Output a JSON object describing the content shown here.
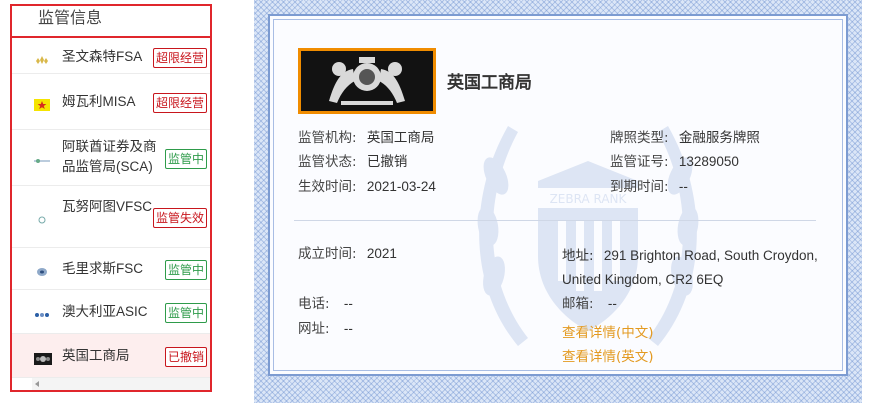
{
  "sidebar": {
    "title": "监管信息",
    "items": [
      {
        "name": "圣文森特FSA",
        "badge": "超限经营",
        "badge_color": "red"
      },
      {
        "name": "姆瓦利MISA",
        "badge": "超限经营",
        "badge_color": "red"
      },
      {
        "name": "阿联酋证券及商品监管局(SCA)",
        "badge": "监管中",
        "badge_color": "green"
      },
      {
        "name": "瓦努阿图VFSC",
        "badge": "监管失效",
        "badge_color": "red"
      },
      {
        "name": "毛里求斯FSC",
        "badge": "监管中",
        "badge_color": "green"
      },
      {
        "name": "澳大利亚ASIC",
        "badge": "监管中",
        "badge_color": "green"
      },
      {
        "name": "英国工商局",
        "badge": "已撤销",
        "badge_color": "red",
        "selected": true
      }
    ]
  },
  "certificate": {
    "title": "英国工商局",
    "fields": {
      "agency": {
        "label": "监管机构:",
        "value": "英国工商局"
      },
      "license_type": {
        "label": "牌照类型:",
        "value": "金融服务牌照"
      },
      "status": {
        "label": "监管状态:",
        "value": "已撤销"
      },
      "license_no": {
        "label": "监管证号:",
        "value": "13289050"
      },
      "effective": {
        "label": "生效时间:",
        "value": "2021-03-24"
      },
      "expiry": {
        "label": "到期时间:",
        "value": "--"
      },
      "founded": {
        "label": "成立时间:",
        "value": "2021"
      },
      "address": {
        "label": "地址:",
        "value": "291 Brighton Road, South Croydon, United Kingdom, CR2 6EQ"
      },
      "phone": {
        "label": "电话:",
        "value": "--"
      },
      "mailbox": {
        "label": "邮箱:",
        "value": "--"
      },
      "website": {
        "label": "网址:",
        "value": "--"
      }
    },
    "links": {
      "details_cn": "查看详情(中文)",
      "details_en": "查看详情(英文)"
    },
    "watermark_text": "ZEBRA RANK"
  },
  "colors": {
    "highlight_border": "#e0262c",
    "badge_red": "#c8161d",
    "badge_green": "#2e9b4a",
    "link": "#e39a21",
    "logo_frame": "#f08c00"
  }
}
